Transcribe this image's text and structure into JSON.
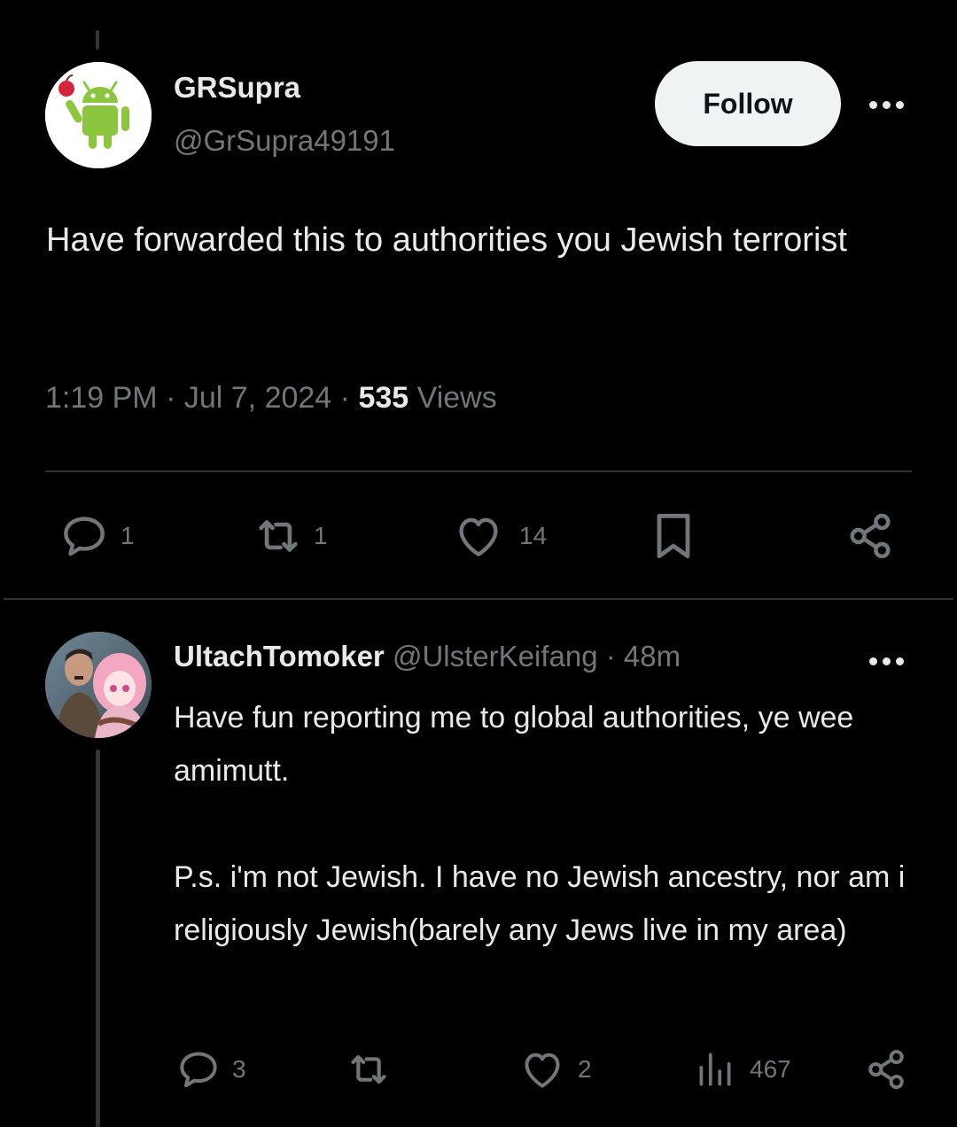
{
  "tweet": {
    "author_name": "GRSupra",
    "author_handle": "@GrSupra49191",
    "follow_label": "Follow",
    "text": "Have forwarded this to authorities you Jewish terrorist",
    "time": "1:19 PM",
    "date": "Jul 7, 2024",
    "views_count": "535",
    "views_label": "Views",
    "actions": {
      "replies": "1",
      "reposts": "1",
      "likes": "14"
    }
  },
  "reply": {
    "author_name": "UltachTomoker",
    "author_handle": "@UlsterKeifang",
    "time_ago": "48m",
    "text": "Have fun reporting me to global authorities, ye wee amimutt.\n\nP.s. i'm not Jewish. I have no Jewish ancestry, nor am i religiously Jewish(barely any Jews live in my area)",
    "actions": {
      "replies": "3",
      "likes": "2",
      "views": "467"
    }
  },
  "icons": {
    "reply": "speech-bubble-icon",
    "repost": "repost-arrows-icon",
    "like": "heart-icon",
    "bookmark": "bookmark-icon",
    "share": "share-icon",
    "views": "bar-chart-icon",
    "more": "more-dots-icon"
  },
  "colors": {
    "background": "#000000",
    "text_primary": "#e7e9ea",
    "text_secondary": "#71767b",
    "divider": "#2f3336",
    "follow_bg": "#eff3f4",
    "avatar_android_green": "#8cc63f"
  }
}
